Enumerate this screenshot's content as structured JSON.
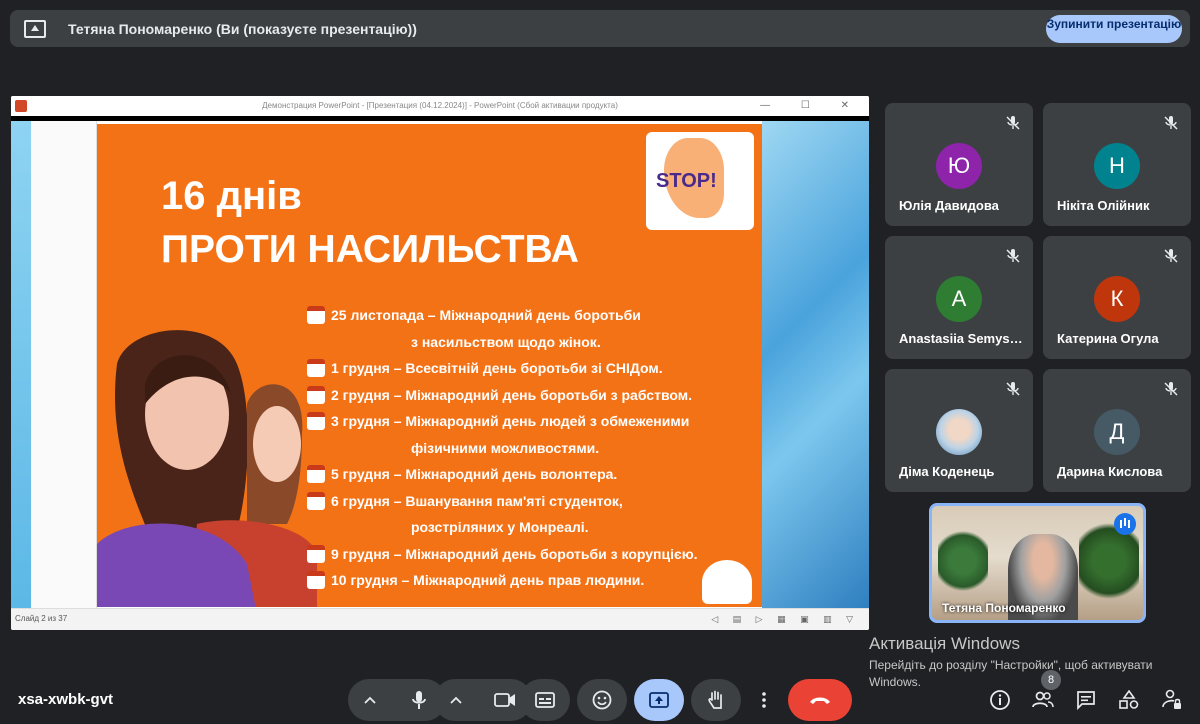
{
  "top_bar": {
    "title": "Тетяна Пономаренко (Ви (показуєте презентацію))",
    "stop_button": "Зупинити презентацію"
  },
  "ppt_window": {
    "title": "Демонстрация PowerPoint - [Презентация (04.12.2024)] - PowerPoint (Сбой активации продукта)",
    "window_controls": "— ☐ ✕",
    "status_left": "Слайд 2 из 37"
  },
  "slide": {
    "title_line1": "16 днів",
    "title_line2": "ПРОТИ НАСИЛЬСТВА",
    "stop_logo_text": "STOP!",
    "events": [
      {
        "text": "25 листопада – Міжнародний день боротьби",
        "icon": true
      },
      {
        "text": "з насильством щодо жінок.",
        "icon": false
      },
      {
        "text": "1 грудня – Всесвітній  день боротьби зі СНІДом.",
        "icon": true
      },
      {
        "text": "2 грудня – Міжнародний день боротьби з рабством.",
        "icon": true
      },
      {
        "text": "3 грудня – Міжнародний день людей з обмеженими",
        "icon": true
      },
      {
        "text": "фізичними можливостями.",
        "icon": false
      },
      {
        "text": "5 грудня – Міжнародний день волонтера.",
        "icon": true
      },
      {
        "text": "6 грудня – Вшанування пам'яті студенток,",
        "icon": true
      },
      {
        "text": "розстріляних у Монреалі.",
        "icon": false
      },
      {
        "text": "9 грудня – Міжнародний день боротьби з корупцією.",
        "icon": true
      },
      {
        "text": "10 грудня – Міжнародний день прав людини.",
        "icon": true
      }
    ]
  },
  "participants": [
    {
      "initial": "Ю",
      "name": "Юлія Давидова",
      "color": "#8e24aa"
    },
    {
      "initial": "Н",
      "name": "Нікіта Олійник",
      "color": "#00838f"
    },
    {
      "initial": "A",
      "name": "Anastasiia Semys…",
      "color": "#2e7d32"
    },
    {
      "initial": "К",
      "name": "Катерина Огула",
      "color": "#bf360c"
    },
    {
      "initial": "",
      "name": "Діма Коденець",
      "color": "#cfd8dc"
    },
    {
      "initial": "Д",
      "name": "Дарина Кислова",
      "color": "#455a64"
    }
  ],
  "self_tile": {
    "name": "Тетяна Пономаренко"
  },
  "activation": {
    "title": "Активація Windows",
    "subtitle": "Перейдіть до розділу \"Настройки\", щоб активувати Windows."
  },
  "toolbar": {
    "meeting_code": "xsa-xwbk-gvt",
    "participants_count": "8"
  }
}
